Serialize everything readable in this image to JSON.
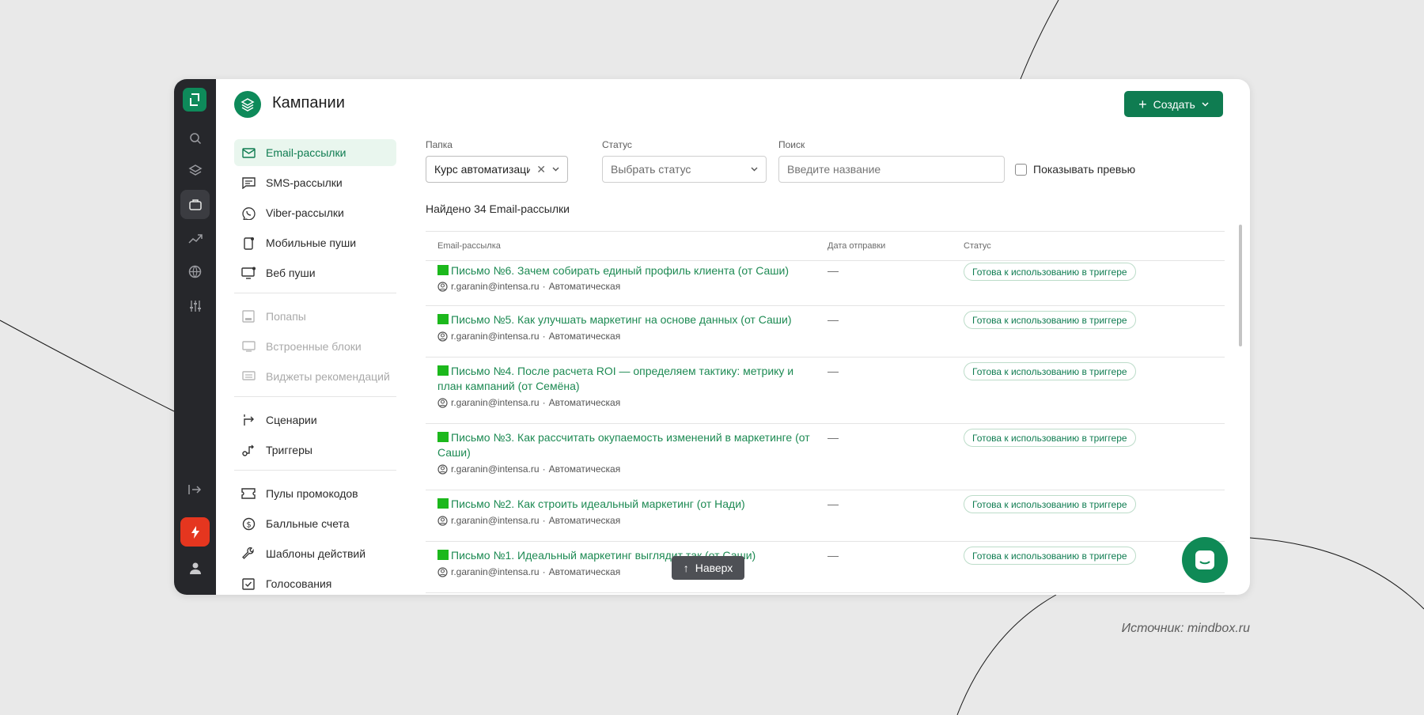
{
  "caption": "Источник: mindbox.ru",
  "header": {
    "title": "Кампании",
    "create_label": "Создать"
  },
  "rail": {
    "icons": [
      "search-icon",
      "layers-icon",
      "briefcase-icon",
      "trend-icon",
      "globe-icon",
      "sliders-icon",
      "logout-icon",
      "bolt-icon",
      "user-icon"
    ]
  },
  "sidebar": {
    "items": [
      {
        "label": "Email-рассылки",
        "icon": "mail-icon",
        "state": "active"
      },
      {
        "label": "SMS-рассылки",
        "icon": "sms-icon",
        "state": "normal"
      },
      {
        "label": "Viber-рассылки",
        "icon": "viber-icon",
        "state": "normal"
      },
      {
        "label": "Мобильные пуши",
        "icon": "mobile-push-icon",
        "state": "normal"
      },
      {
        "label": "Веб пуши",
        "icon": "web-push-icon",
        "state": "normal"
      },
      {
        "label": "Попапы",
        "icon": "popup-icon",
        "state": "disabled"
      },
      {
        "label": "Встроенные блоки",
        "icon": "embedded-icon",
        "state": "disabled"
      },
      {
        "label": "Виджеты рекомендаций",
        "icon": "widget-icon",
        "state": "disabled"
      },
      {
        "label": "Сценарии",
        "icon": "scenario-icon",
        "state": "normal"
      },
      {
        "label": "Триггеры",
        "icon": "trigger-icon",
        "state": "normal"
      },
      {
        "label": "Пулы промокодов",
        "icon": "ticket-icon",
        "state": "normal"
      },
      {
        "label": "Балльные счета",
        "icon": "dollar-icon",
        "state": "normal"
      },
      {
        "label": "Шаблоны действий",
        "icon": "wrench-icon",
        "state": "normal"
      },
      {
        "label": "Голосования",
        "icon": "vote-icon",
        "state": "normal"
      }
    ]
  },
  "filters": {
    "folder_label": "Папка",
    "folder_value": "Курс автоматизаци...",
    "status_label": "Статус",
    "status_placeholder": "Выбрать статус",
    "search_label": "Поиск",
    "search_placeholder": "Введите название",
    "preview_label": "Показывать превью"
  },
  "found_text": "Найдено 34 Email-рассылки",
  "table": {
    "columns": [
      "Email-рассылка",
      "Дата отправки",
      "Статус"
    ],
    "rows": [
      {
        "title": "Письмо №6. Зачем собирать единый профиль клиента (от Саши)",
        "author": "r.garanin@intensa.ru",
        "type": "Автоматическая",
        "date": "—",
        "status": "Готова к использованию в триггере"
      },
      {
        "title": "Письмо №5. Как улучшать маркетинг на основе данных (от Саши)",
        "author": "r.garanin@intensa.ru",
        "type": "Автоматическая",
        "date": "—",
        "status": "Готова к использованию в триггере"
      },
      {
        "title": "Письмо №4. После расчета ROI — определяем тактику: метрику и план кампаний (от Семёна)",
        "author": "r.garanin@intensa.ru",
        "type": "Автоматическая",
        "date": "—",
        "status": "Готова к использованию в триггере"
      },
      {
        "title": "Письмо №3. Как рассчитать окупаемость изменений в маркетинге (от Саши)",
        "author": "r.garanin@intensa.ru",
        "type": "Автоматическая",
        "date": "—",
        "status": "Готова к использованию в триггере"
      },
      {
        "title": "Письмо №2. Как строить идеальный маркетинг (от Нади)",
        "author": "r.garanin@intensa.ru",
        "type": "Автоматическая",
        "date": "—",
        "status": "Готова к использованию в триггере"
      },
      {
        "title": "Письмо №1. Идеальный маркетинг выглядит так (от Саши)",
        "author": "r.garanin@intensa.ru",
        "type": "Автоматическая",
        "date": "—",
        "status": "Готова к использованию в триггере"
      }
    ]
  },
  "to_top_label": "Наверх",
  "colors": {
    "accent": "#0f7c51",
    "rail": "#26272b",
    "bolt": "#e5361f",
    "status_square": "#1cb81c"
  }
}
